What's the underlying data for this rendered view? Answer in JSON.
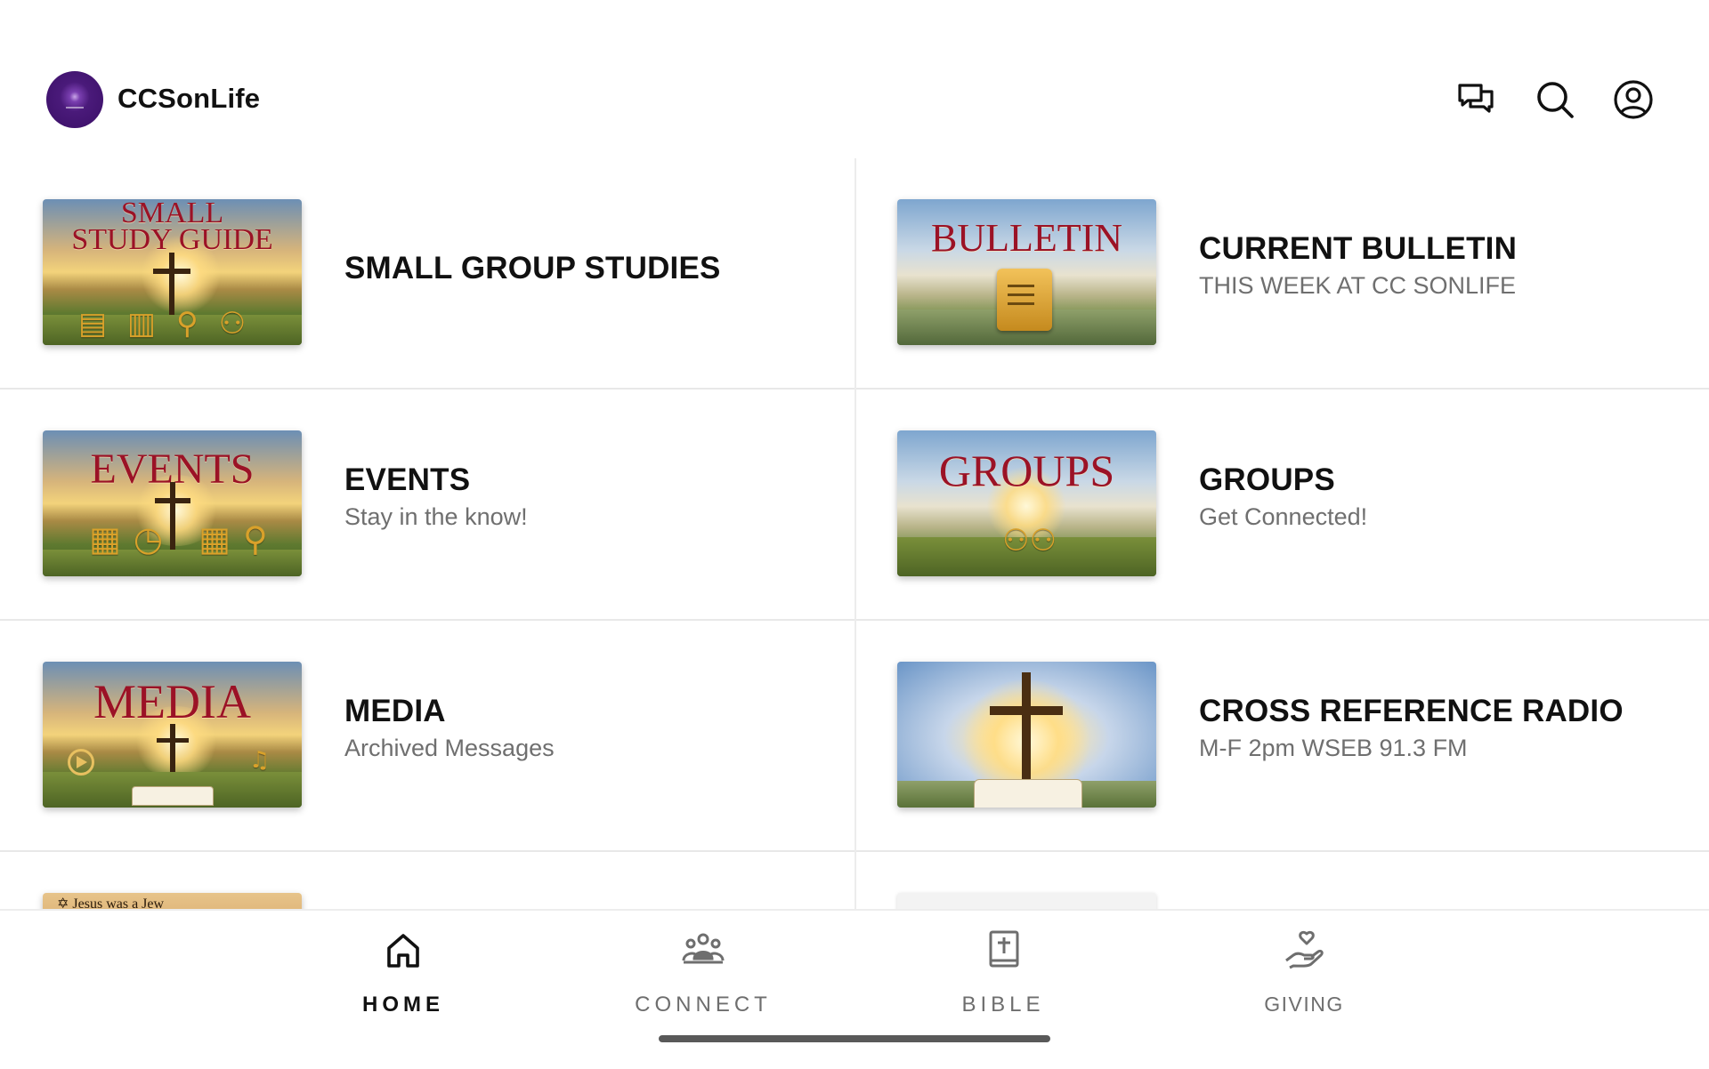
{
  "header": {
    "app_name": "CCSonLife",
    "icons": [
      "chat-icon",
      "search-icon",
      "account-icon"
    ]
  },
  "tiles": [
    {
      "title": "SMALL GROUP STUDIES",
      "subtitle": "",
      "thumb_text": [
        "SMALL",
        "STUDY GUIDE"
      ]
    },
    {
      "title": "CURRENT BULLETIN",
      "subtitle": "THIS WEEK AT CC SONLIFE",
      "thumb_text": [
        "BULLETIN"
      ]
    },
    {
      "title": "EVENTS",
      "subtitle": "Stay in the know!",
      "thumb_text": [
        "EVENTS"
      ]
    },
    {
      "title": "GROUPS",
      "subtitle": "Get Connected!",
      "thumb_text": [
        "GROUPS"
      ]
    },
    {
      "title": "MEDIA",
      "subtitle": "Archived Messages",
      "thumb_text": [
        "MEDIA"
      ]
    },
    {
      "title": "CROSS REFERENCE RADIO",
      "subtitle": "M-F 2pm WSEB 91.3 FM",
      "thumb_text": []
    },
    {
      "title": "",
      "subtitle": "",
      "thumb_text": [
        "Jesus was a Jew"
      ]
    },
    {
      "title": "",
      "subtitle": "",
      "thumb_text": []
    }
  ],
  "bottom_nav": {
    "items": [
      {
        "label": "HOME",
        "icon": "home-icon",
        "active": true
      },
      {
        "label": "CONNECT",
        "icon": "people-icon",
        "active": false
      },
      {
        "label": "BIBLE",
        "icon": "bible-icon",
        "active": false
      },
      {
        "label": "GIVING",
        "icon": "giving-icon",
        "active": false
      }
    ]
  },
  "colors": {
    "logo_purple": "#3a0f66",
    "thumb_title_red": "#9b1226",
    "text_primary": "#111111",
    "text_secondary": "#6f6f6f",
    "nav_inactive": "#6e6e6e"
  }
}
